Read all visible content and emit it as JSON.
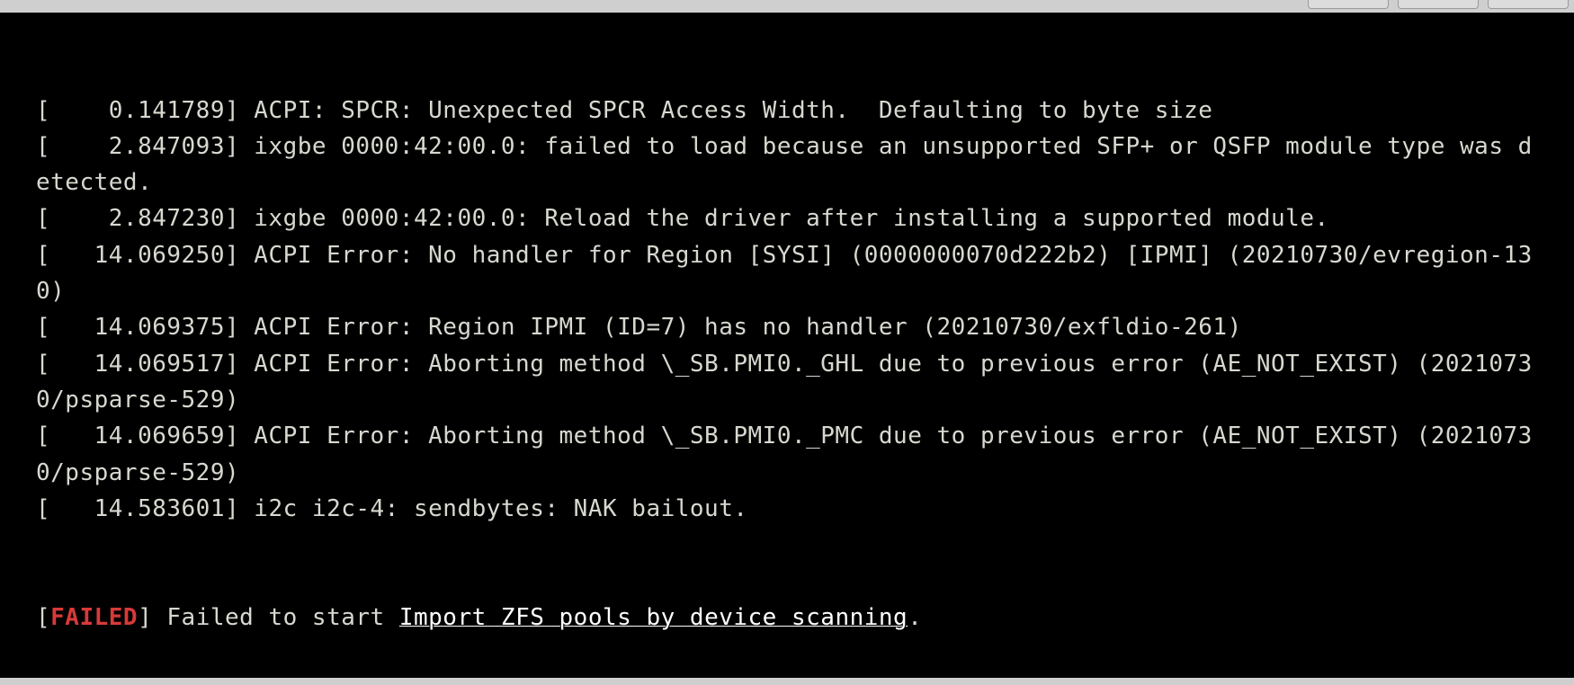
{
  "terminal": {
    "lines": [
      {
        "text": "[    0.141789] ACPI: SPCR: Unexpected SPCR Access Width.  Defaulting to byte size"
      },
      {
        "text": "[    2.847093] ixgbe 0000:42:00.0: failed to load because an unsupported SFP+ or QSFP module type was detected."
      },
      {
        "text": "[    2.847230] ixgbe 0000:42:00.0: Reload the driver after installing a supported module."
      },
      {
        "text": "[   14.069250] ACPI Error: No handler for Region [SYSI] (0000000070d222b2) [IPMI] (20210730/evregion-130)"
      },
      {
        "text": "[   14.069375] ACPI Error: Region IPMI (ID=7) has no handler (20210730/exfldio-261)"
      },
      {
        "text": "[   14.069517] ACPI Error: Aborting method \\_SB.PMI0._GHL due to previous error (AE_NOT_EXIST) (20210730/psparse-529)"
      },
      {
        "text": "[   14.069659] ACPI Error: Aborting method \\_SB.PMI0._PMC due to previous error (AE_NOT_EXIST) (20210730/psparse-529)"
      },
      {
        "text": "[   14.583601] i2c i2c-4: sendbytes: NAK bailout."
      }
    ],
    "failed_line": {
      "open": "[",
      "status": "FAILED",
      "close": "] Failed to start ",
      "unit": "Import ZFS pools by device scanning",
      "tail": "."
    }
  }
}
